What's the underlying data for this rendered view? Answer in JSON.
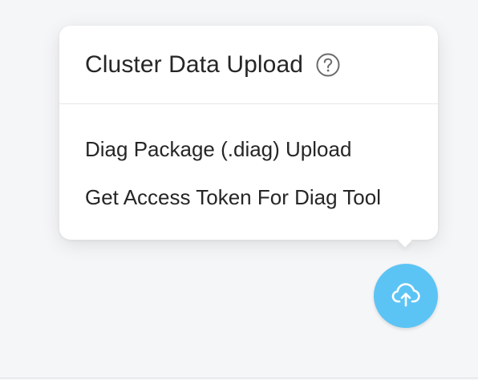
{
  "popover": {
    "title": "Cluster Data Upload",
    "help_icon": "question-circle-icon",
    "menu_items": [
      {
        "label": "Diag Package (.diag) Upload"
      },
      {
        "label": "Get Access Token For Diag Tool"
      }
    ]
  },
  "fab": {
    "icon": "cloud-upload-icon",
    "color": "#5cc4f5"
  },
  "colors": {
    "background": "#f5f6f8",
    "popover_bg": "#ffffff",
    "text": "#262626",
    "divider": "#e6e8eb",
    "icon_gray": "#6b6b6b"
  }
}
